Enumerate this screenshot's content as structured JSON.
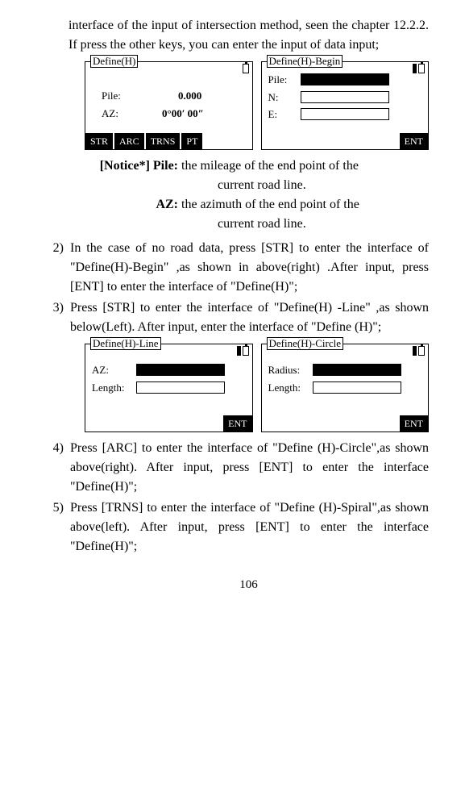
{
  "intro": "interface of the input of intersection method, seen the chapter 12.2.2. If press the other keys, you can enter the input of data input;",
  "box1": {
    "title": "Define(H)",
    "pile_label": "Pile:",
    "pile_value": "0.000",
    "az_label": "AZ:",
    "az_value": "0°00′ 00″",
    "softkeys": [
      "STR",
      "ARC",
      "TRNS",
      "PT"
    ]
  },
  "box2": {
    "title": "Define(H)-Begin",
    "pile_label": "Pile:",
    "n_label": "N:",
    "e_label": "E:",
    "ent": "ENT"
  },
  "notice": {
    "label": "[Notice*]  Pile:",
    "text1a": "the mileage of the end point of the",
    "text1b": "current road line.",
    "az_label": "AZ:",
    "text2a": "the azimuth of the end point of the",
    "text2b": "current road line."
  },
  "step2_num": "2)",
  "step2": "In the case of no road data, press [STR] to enter the interface of \"Define(H)-Begin\" ,as shown in above(right) .After input, press [ENT] to enter the interface of \"Define(H)\";",
  "step3_num": "3)",
  "step3": "Press [STR] to enter the interface of \"Define(H) -Line\" ,as shown below(Left). After input, enter the interface of \"Define (H)\";",
  "box3": {
    "title": "Define(H)-Line",
    "az_label": "AZ:",
    "len_label": "Length:",
    "ent": "ENT"
  },
  "box4": {
    "title": "Define(H)-Circle",
    "rad_label": "Radius:",
    "len_label": "Length:",
    "ent": "ENT"
  },
  "step4_num": "4)",
  "step4": "Press [ARC] to enter the interface of \"Define (H)-Circle\",as shown above(right). After input, press [ENT] to enter the interface \"Define(H)\";",
  "step5_num": "5)",
  "step5": "Press [TRNS] to enter the interface of \"Define (H)-Spiral\",as shown above(left). After input, press [ENT] to enter the interface \"Define(H)\";",
  "page_num": "106"
}
